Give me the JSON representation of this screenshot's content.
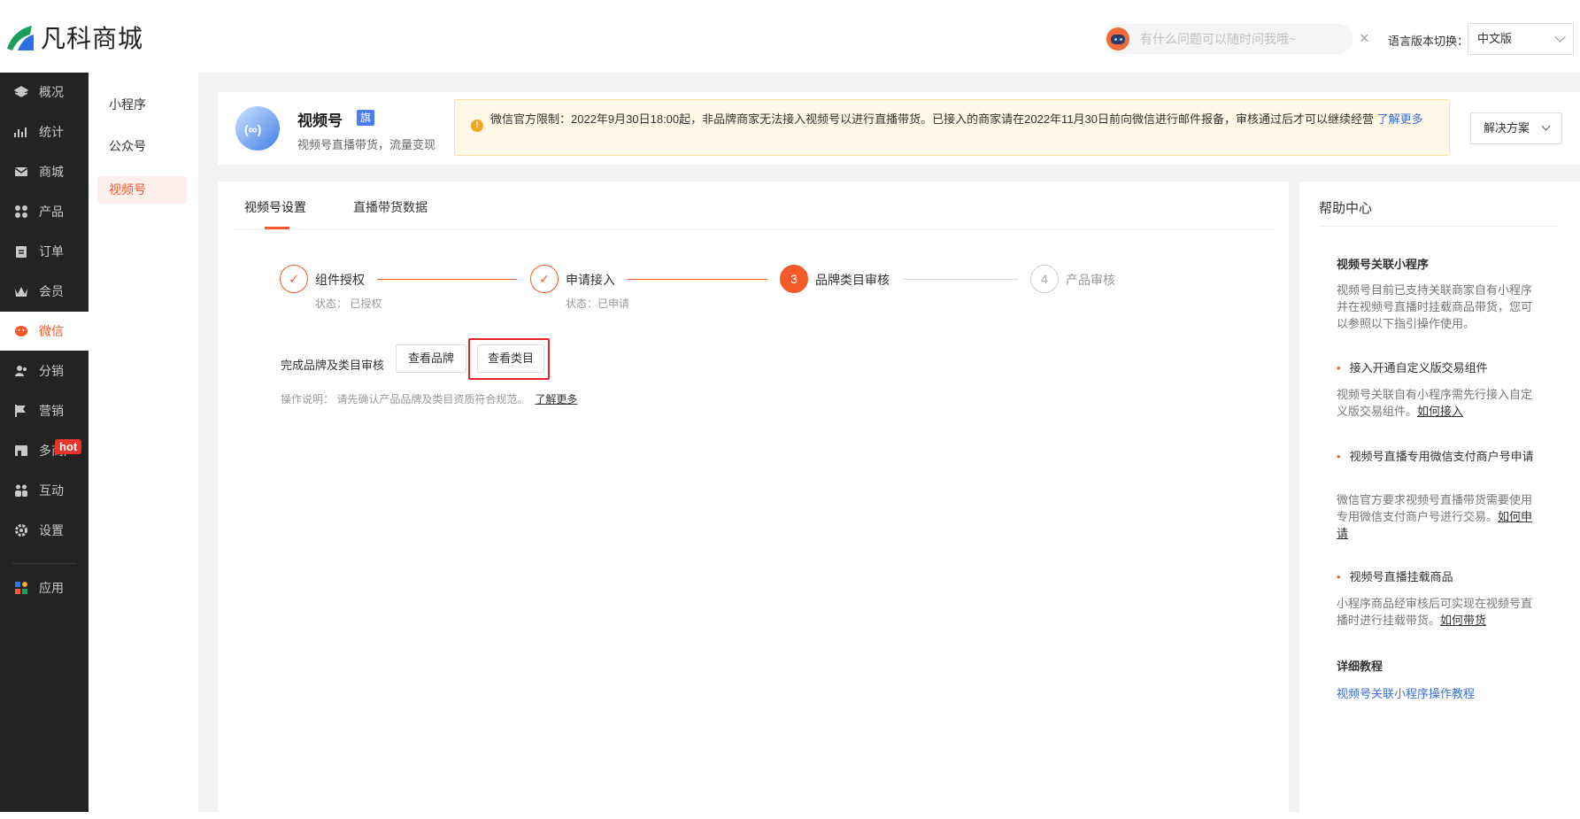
{
  "topbar": {
    "logo_text": "凡科商城",
    "assistant_placeholder": "有什么问题可以随时问我哦~",
    "close_symbol": "×",
    "lang_label": "语言版本切换：",
    "lang_value": "中文版"
  },
  "sidebar": {
    "items": [
      {
        "label": "概况"
      },
      {
        "label": "统计"
      },
      {
        "label": "商城"
      },
      {
        "label": "产品"
      },
      {
        "label": "订单"
      },
      {
        "label": "会员"
      },
      {
        "label": "微信"
      },
      {
        "label": "分销"
      },
      {
        "label": "营销"
      },
      {
        "label": "多商户"
      },
      {
        "label": "互动"
      },
      {
        "label": "设置"
      },
      {
        "label": "应用"
      }
    ],
    "hot_badge": "hot",
    "active_color": "#f45a2a"
  },
  "subsidebar": {
    "items": [
      {
        "label": "小程序"
      },
      {
        "label": "公众号"
      },
      {
        "label": "视频号"
      }
    ]
  },
  "header": {
    "logo_text": "(∞)",
    "title": "视频号",
    "badge": "旗",
    "subtitle": "视频号直播带货，流量变现",
    "notice_text": "微信官方限制：2022年9月30日18:00起，非品牌商家无法接入视频号以进行直播带货。已接入的商家请在2022年11月30日前向微信进行邮件报备，审核通过后才可以继续经营",
    "notice_link": "了解更多",
    "solution_button": "解决方案"
  },
  "tabs": [
    {
      "label": "视频号设置"
    },
    {
      "label": "直播带货数据"
    }
  ],
  "steps": [
    {
      "index": "✓",
      "title": "组件授权",
      "state": "状态： 已授权"
    },
    {
      "index": "✓",
      "title": "申请接入",
      "state": "状态：已申请"
    },
    {
      "index": "3",
      "title": "品牌类目审核",
      "state": ""
    },
    {
      "index": "4",
      "title": "产品审核",
      "state": ""
    }
  ],
  "review": {
    "label": "完成品牌及类目审核",
    "view_brand": "查看品牌",
    "view_category": "查看类目",
    "op_note": "操作说明： 请先确认产品品牌及类目资质符合规范。",
    "op_link": "了解更多"
  },
  "help": {
    "title": "帮助中心",
    "section1_title": "视频号关联小程序",
    "section1_text": "视频号目前已支持关联商家自有小程序并在视频号直播时挂载商品带货，您可以参照以下指引操作使用。",
    "b1_title": "接入开通自定义版交易组件",
    "b1_text": "视频号关联自有小程序需先行接入自定义版交易组件。",
    "b1_link": "如何接入",
    "b2_title": "视频号直播专用微信支付商户号申请",
    "b2_text": "微信官方要求视频号直播带货需要使用专用微信支付商户号进行交易。",
    "b2_link": "如何申请",
    "b3_title": "视频号直播挂载商品",
    "b3_text": "小程序商品经审核后可实现在视频号直播时进行挂载带货。",
    "b3_link": "如何带货",
    "tutorial_title": "详细教程",
    "tutorial_link": "视频号关联小程序操作教程"
  }
}
